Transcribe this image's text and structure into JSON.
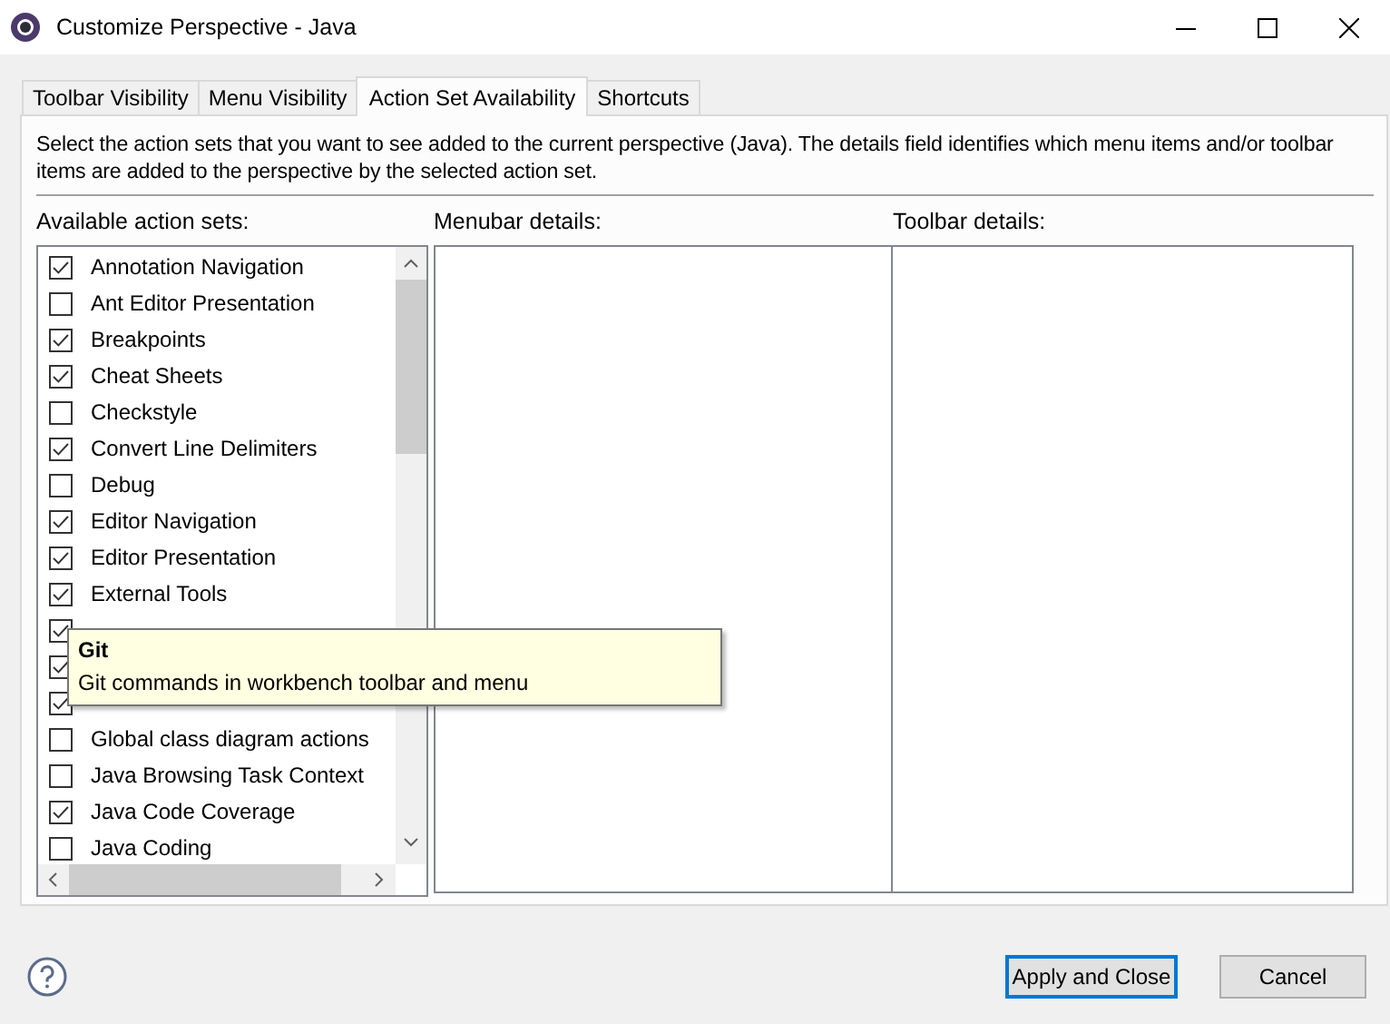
{
  "window": {
    "title": "Customize Perspective - Java"
  },
  "tabs": [
    {
      "label": "Toolbar Visibility",
      "selected": false
    },
    {
      "label": "Menu Visibility",
      "selected": false
    },
    {
      "label": "Action Set Availability",
      "selected": true
    },
    {
      "label": "Shortcuts",
      "selected": false
    }
  ],
  "description": "Select the action sets that you want to see added to the current perspective (Java). The details field identifies which menu items and/or toolbar items are added to the perspective by the selected action set.",
  "action_sets": {
    "label": "Available action sets:",
    "items": [
      {
        "label": "Annotation Navigation",
        "checked": true
      },
      {
        "label": "Ant Editor Presentation",
        "checked": false
      },
      {
        "label": "Breakpoints",
        "checked": true
      },
      {
        "label": "Cheat Sheets",
        "checked": true
      },
      {
        "label": "Checkstyle",
        "checked": false
      },
      {
        "label": "Convert Line Delimiters",
        "checked": true
      },
      {
        "label": "Debug",
        "checked": false
      },
      {
        "label": "Editor Navigation",
        "checked": true
      },
      {
        "label": "Editor Presentation",
        "checked": true
      },
      {
        "label": "External Tools",
        "checked": true
      },
      {
        "checked": true
      },
      {
        "checked": true
      },
      {
        "checked": true
      },
      {
        "label": "Global class diagram actions",
        "checked": false
      },
      {
        "label": "Java Browsing Task Context",
        "checked": false
      },
      {
        "label": "Java Code Coverage",
        "checked": true
      },
      {
        "label": "Java Coding",
        "checked": false
      }
    ]
  },
  "menubar_details": {
    "label": "Menubar details:"
  },
  "toolbar_details": {
    "label": "Toolbar details:"
  },
  "tooltip": {
    "title": "Git",
    "text": "Git commands in workbench toolbar and menu"
  },
  "buttons": [
    {
      "label": "Apply and Close",
      "default": true
    },
    {
      "label": "Cancel",
      "default": false
    }
  ]
}
